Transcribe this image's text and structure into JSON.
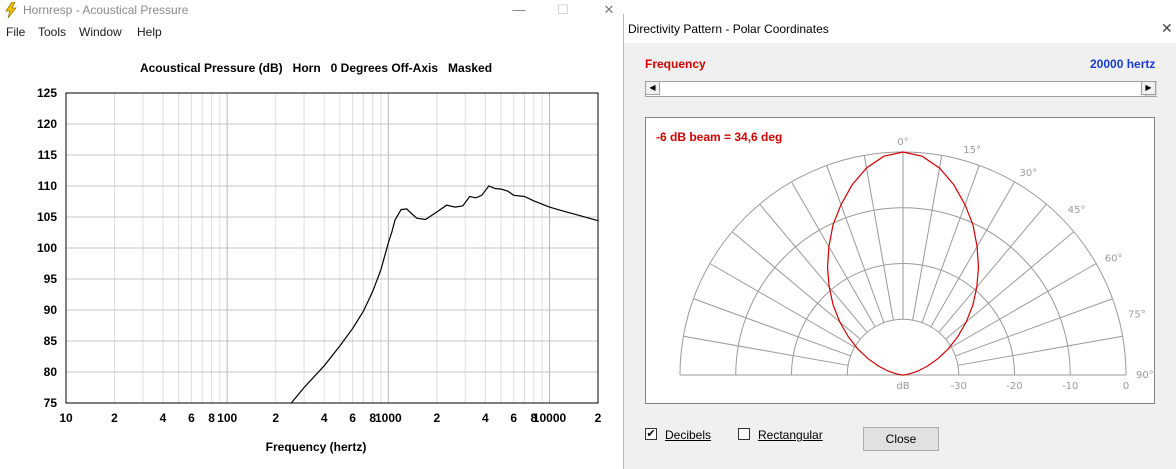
{
  "app": {
    "title": "Hornresp - Acoustical Pressure",
    "icon": "lightning-icon",
    "window_buttons": {
      "minimize": "—",
      "maximize": "☐",
      "close": "✕"
    }
  },
  "menu": {
    "items": [
      "File",
      "Tools",
      "Window",
      "Help"
    ]
  },
  "chart_data": {
    "type": "line",
    "title": "Acoustical Pressure (dB)   Horn   0 Degrees Off-Axis   Masked",
    "xlabel": "Frequency (hertz)",
    "ylabel": "",
    "xscale": "log",
    "xlim": [
      10,
      20000
    ],
    "ylim": [
      75,
      125
    ],
    "x_tick_labels": [
      {
        "value": 10,
        "label": "10"
      },
      {
        "value": 20,
        "label": "2"
      },
      {
        "value": 40,
        "label": "4"
      },
      {
        "value": 60,
        "label": "6"
      },
      {
        "value": 80,
        "label": "8"
      },
      {
        "value": 100,
        "label": "100"
      },
      {
        "value": 200,
        "label": "2"
      },
      {
        "value": 400,
        "label": "4"
      },
      {
        "value": 600,
        "label": "6"
      },
      {
        "value": 800,
        "label": "8"
      },
      {
        "value": 1000,
        "label": "1000"
      },
      {
        "value": 2000,
        "label": "2"
      },
      {
        "value": 4000,
        "label": "4"
      },
      {
        "value": 6000,
        "label": "6"
      },
      {
        "value": 8000,
        "label": "8"
      },
      {
        "value": 10000,
        "label": "10000"
      },
      {
        "value": 20000,
        "label": "2"
      }
    ],
    "y_ticks": [
      75,
      80,
      85,
      90,
      95,
      100,
      105,
      110,
      115,
      120,
      125
    ],
    "grid": true,
    "line_color": "#000000",
    "series": [
      {
        "x": [
          250,
          300,
          400,
          500,
          600,
          700,
          800,
          900,
          1000,
          1050,
          1100,
          1200,
          1300,
          1400,
          1500,
          1700,
          2000,
          2300,
          2600,
          2900,
          3200,
          3500,
          3800,
          4200,
          4600,
          5000,
          5500,
          6000,
          7000,
          8000,
          10000,
          12000,
          15000,
          20000
        ],
        "y": [
          75,
          77.5,
          81,
          84.2,
          87,
          89.8,
          93,
          96.5,
          100.8,
          102.5,
          104.5,
          106.2,
          106.3,
          105.5,
          104.8,
          104.6,
          105.8,
          106.9,
          106.6,
          106.8,
          108.3,
          108.1,
          108.5,
          110.0,
          109.6,
          109.5,
          109.2,
          108.5,
          108.3,
          107.6,
          106.6,
          106.0,
          105.3,
          104.4
        ]
      }
    ]
  },
  "dialog": {
    "title": "Directivity Pattern - Polar Coordinates",
    "close_glyph": "✕",
    "frequency_label": "Frequency",
    "frequency_value": "20000 hertz",
    "scroll_left": "◀",
    "scroll_right": "▶",
    "beam_text": "-6 dB beam = 34,6 deg",
    "angle_labels": [
      "0°",
      "15°",
      "30°",
      "45°",
      "60°",
      "75°",
      "90°"
    ],
    "angle_values": [
      0,
      15,
      30,
      45,
      60,
      75,
      90
    ],
    "ring_labels": [
      "dB",
      "-30",
      "-20",
      "-10",
      "0"
    ],
    "ring_values": [
      -40,
      -30,
      -20,
      -10,
      0
    ],
    "pattern_color": "#d00000",
    "pattern": {
      "angles": [
        0,
        5,
        10,
        15,
        20,
        25,
        30,
        35,
        40,
        45,
        50,
        55,
        60,
        65,
        70,
        75,
        80,
        85,
        90
      ],
      "db": [
        0,
        -0.6,
        -2.3,
        -4.7,
        -7.5,
        -10.3,
        -13.4,
        -16.4,
        -19.4,
        -22.3,
        -25.2,
        -28.0,
        -30.6,
        -33.1,
        -35.3,
        -37.2,
        -38.7,
        -39.7,
        -40
      ]
    },
    "decibels_label": "Decibels",
    "decibels_checked": "✔",
    "rectangular_label": "Rectangular",
    "close_label": "Close"
  }
}
